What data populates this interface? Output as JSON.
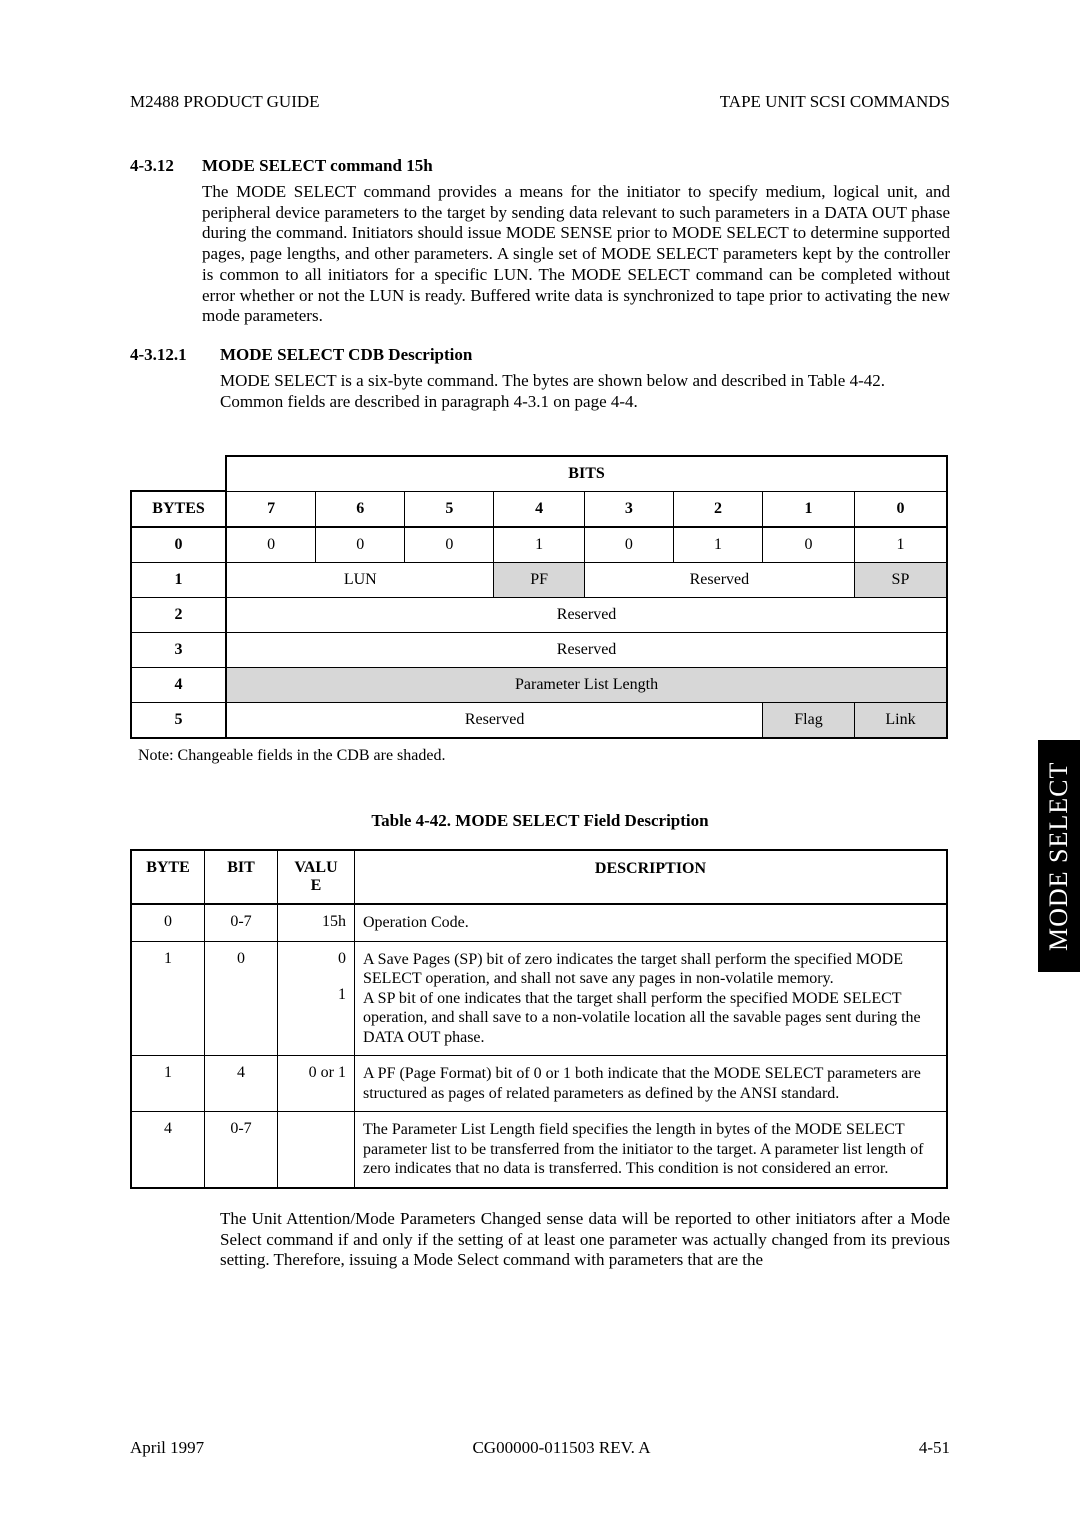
{
  "header": {
    "left": "M2488 PRODUCT GUIDE",
    "right": "TAPE UNIT SCSI COMMANDS"
  },
  "section": {
    "num": "4-3.12",
    "title": "MODE SELECT command 15h",
    "para": "The MODE SELECT command provides a means for the initiator to specify medium, logical unit, and peripheral device parameters to the target by sending data relevant to such parameters in a DATA OUT phase during the command. Initiators should issue MODE SENSE prior to MODE SELECT to determine supported pages, page lengths, and other parameters. A single set of MODE SELECT parameters kept by the controller is common to all initiators for a specific LUN. The MODE SELECT command can be completed without error whether or not the LUN is ready. Buffered write data is synchronized to tape prior to activating the new mode parameters."
  },
  "subsection": {
    "num": "4-3.12.1",
    "title": "MODE SELECT CDB Description",
    "para": "MODE SELECT is a six-byte command. The bytes are shown below and described in Table 4-42. Common fields are described in paragraph  4-3.1 on page 4-4."
  },
  "cdb_table": {
    "bits_header": "BITS",
    "bytes_header": "BYTES",
    "bit_cols": [
      "7",
      "6",
      "5",
      "4",
      "3",
      "2",
      "1",
      "0"
    ],
    "rows": [
      {
        "byte": "0",
        "cells": [
          {
            "text": "0",
            "span": 1,
            "shaded": false
          },
          {
            "text": "0",
            "span": 1,
            "shaded": false
          },
          {
            "text": "0",
            "span": 1,
            "shaded": false
          },
          {
            "text": "1",
            "span": 1,
            "shaded": false
          },
          {
            "text": "0",
            "span": 1,
            "shaded": false
          },
          {
            "text": "1",
            "span": 1,
            "shaded": false
          },
          {
            "text": "0",
            "span": 1,
            "shaded": false
          },
          {
            "text": "1",
            "span": 1,
            "shaded": false
          }
        ]
      },
      {
        "byte": "1",
        "cells": [
          {
            "text": "LUN",
            "span": 3,
            "shaded": false
          },
          {
            "text": "PF",
            "span": 1,
            "shaded": true
          },
          {
            "text": "Reserved",
            "span": 3,
            "shaded": false
          },
          {
            "text": "SP",
            "span": 1,
            "shaded": true
          }
        ]
      },
      {
        "byte": "2",
        "cells": [
          {
            "text": "Reserved",
            "span": 8,
            "shaded": false
          }
        ]
      },
      {
        "byte": "3",
        "cells": [
          {
            "text": "Reserved",
            "span": 8,
            "shaded": false
          }
        ]
      },
      {
        "byte": "4",
        "cells": [
          {
            "text": "Parameter List Length",
            "span": 8,
            "shaded": true
          }
        ]
      },
      {
        "byte": "5",
        "cells": [
          {
            "text": "Reserved",
            "span": 6,
            "shaded": false
          },
          {
            "text": "Flag",
            "span": 1,
            "shaded": true
          },
          {
            "text": "Link",
            "span": 1,
            "shaded": true
          }
        ]
      }
    ],
    "note": "Note: Changeable fields in the CDB are shaded."
  },
  "desc_table": {
    "caption": "Table 4-42.   MODE SELECT Field Description",
    "headers": {
      "byte": "BYTE",
      "bit": "BIT",
      "value": "VALU\nE",
      "desc": "DESCRIPTION"
    },
    "rows": [
      {
        "byte": "0",
        "bit": "0-7",
        "value": "15h",
        "desc": "Operation Code."
      },
      {
        "byte": "1",
        "bit": "0",
        "value": "0\n\n1",
        "desc": "A Save Pages (SP) bit of zero indicates the target shall perform the specified MODE SELECT operation, and shall not save any pages in non-volatile memory.\nA SP bit of one indicates that the target shall perform the specified MODE SELECT operation, and shall save to a non-volatile location all the savable pages sent during the DATA OUT phase."
      },
      {
        "byte": "1",
        "bit": "4",
        "value": "0 or 1",
        "desc": "A PF (Page Format) bit of 0 or 1 both indicate that the MODE SELECT parameters are structured as pages of related parameters as defined by the ANSI standard."
      },
      {
        "byte": "4",
        "bit": "0-7",
        "value": "",
        "desc": "The Parameter List Length field specifies the length in bytes of the MODE SELECT parameter list to be transferred from the initiator to the target. A parameter list length of zero indicates that no data is transferred. This condition is not considered an error."
      }
    ]
  },
  "tail_para": "The Unit Attention/Mode Parameters Changed sense data will be reported to other initiators after a Mode Select command if and only if the setting of at least one parameter was actually changed from its previous setting. Therefore, issuing a Mode Select command with parameters that are the",
  "footer": {
    "left": "April 1997",
    "center": "CG00000-011503 REV. A",
    "right": "4-51"
  },
  "side_tab": "MODE SELECT"
}
